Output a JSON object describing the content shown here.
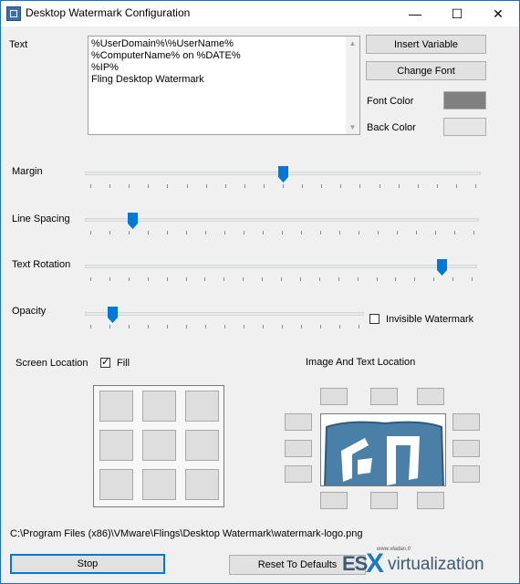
{
  "window": {
    "title": "Desktop Watermark Configuration",
    "controls": {
      "minimize": "—",
      "maximize": "☐",
      "close": "✕"
    }
  },
  "text_section": {
    "label": "Text",
    "lines": [
      "%UserDomain%\\%UserName%",
      "%ComputerName% on %DATE%",
      "%IP%",
      "Fling Desktop Watermark"
    ],
    "insert_variable_label": "Insert Variable",
    "change_font_label": "Change Font",
    "font_color_label": "Font Color",
    "back_color_label": "Back Color",
    "font_color": "#808080",
    "back_color": "#e6e6e6"
  },
  "sliders": {
    "margin": {
      "label": "Margin",
      "value": 0.5
    },
    "line_spacing": {
      "label": "Line Spacing",
      "value": 0.11
    },
    "text_rotation": {
      "label": "Text Rotation",
      "value": 0.92
    },
    "opacity": {
      "label": "Opacity",
      "value": 0.08
    }
  },
  "invisible_watermark": {
    "label": "Invisible Watermark",
    "checked": false
  },
  "screen_location": {
    "label": "Screen Location",
    "fill_label": "Fill",
    "fill_checked": true
  },
  "image_text_location": {
    "label": "Image And Text Location"
  },
  "file_path": "C:\\Program Files (x86)\\VMware\\Flings\\Desktop Watermark\\watermark-logo.png",
  "buttons": {
    "stop_label": "Stop",
    "reset_label": "Reset To Defaults"
  },
  "branding": {
    "site": "www.vladan.fr",
    "logo_left": "ES",
    "logo_x": "X",
    "logo_right": "virtualization"
  },
  "colors": {
    "accent": "#0078d7",
    "preview_blue": "#4a7fa8"
  }
}
